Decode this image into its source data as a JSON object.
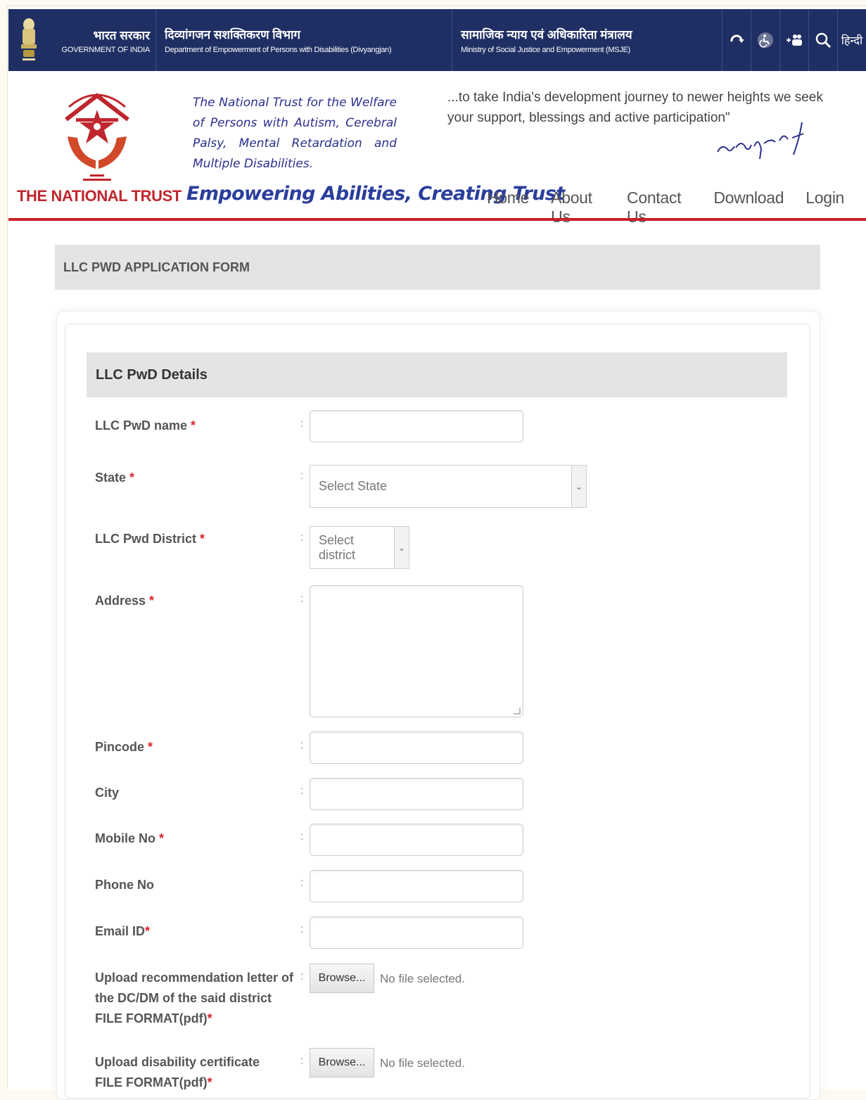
{
  "gov": {
    "india_hi": "भारत सरकार",
    "india_en": "GOVERNMENT OF INDIA",
    "dept_hi": "दिव्यांगजन सशक्तिकरण विभाग",
    "dept_en": "Department of Empowerment of Persons with Disabilities (Divyangjan)",
    "ministry_hi": "सामाजिक न्याय एवं अधिकारिता मंत्रालय",
    "ministry_en": "Ministry of Social Justice and Empowerment (MSJE)",
    "language_label": "हिन्दी",
    "tool_icons": [
      "skip-to-content-icon",
      "accessibility-icon",
      "font-size-icon",
      "search-icon"
    ]
  },
  "brand": {
    "trust_description": "The National Trust for the Welfare of Persons with Autism, Cerebral Palsy, Mental Retardation and Multiple Disabilities.",
    "quote": "...to take India's development journey to newer heights we seek your support, blessings and active participation\"",
    "name": "THE NATIONAL TRUST",
    "tagline": "Empowering Abilities, Creating Trust",
    "colors": {
      "navy": "#1f2f63",
      "red": "#c8202a",
      "tagline_blue": "#2b3e9c"
    }
  },
  "nav": {
    "items": [
      "Home",
      "About Us",
      "Contact Us",
      "Download",
      "Login"
    ]
  },
  "page": {
    "heading": "LLC PWD APPLICATION FORM"
  },
  "form": {
    "section_title": "LLC PwD Details",
    "fields": {
      "name": {
        "label": "LLC PwD name",
        "required": "*"
      },
      "state": {
        "label": "State",
        "required": "*",
        "value": "Select State"
      },
      "district": {
        "label": "LLC Pwd District",
        "required": "*",
        "value": "Select district"
      },
      "address": {
        "label": "Address",
        "required": "*"
      },
      "pincode": {
        "label": "Pincode",
        "required": "*"
      },
      "city": {
        "label": "City"
      },
      "mobile": {
        "label": "Mobile No",
        "required": "*"
      },
      "phone": {
        "label": "Phone No"
      },
      "email": {
        "label": "Email ID",
        "required": "*"
      },
      "upload_letter": {
        "label_line1": "Upload recommendation letter of",
        "label_line2": "the DC/DM of the said district",
        "label_line3": "FILE FORMAT(pdf)",
        "required": "*",
        "button": "Browse...",
        "status": "No file selected."
      },
      "upload_cert": {
        "label_line1": "Upload disability certificate",
        "label_line2": "FILE FORMAT(pdf)",
        "required": "*",
        "button": "Browse...",
        "status": "No file selected."
      }
    },
    "colon": ":"
  }
}
